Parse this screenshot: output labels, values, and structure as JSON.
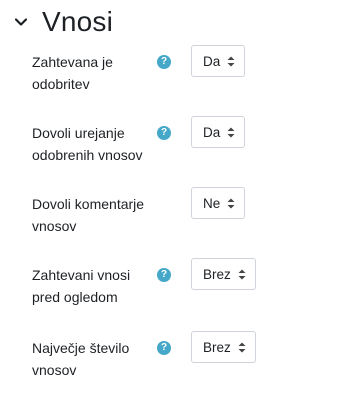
{
  "section": {
    "title": "Vnosi",
    "chevron_icon": "chevron-down-icon"
  },
  "settings": [
    {
      "label": "Zahtevana je odobritev",
      "help_icon": "help-icon",
      "value": "Da"
    },
    {
      "label": "Dovoli urejanje odobrenih vnosov",
      "help_icon": "help-icon",
      "value": "Da"
    },
    {
      "label": "Dovoli komentarje vnosov",
      "help_icon": null,
      "value": "Ne"
    },
    {
      "label": "Zahtevani vnosi pred ogledom",
      "help_icon": "help-icon",
      "value": "Brez"
    },
    {
      "label": "Največje število vnosov",
      "help_icon": "help-icon",
      "value": "Brez"
    }
  ],
  "colors": {
    "help_icon": "#45a8c9",
    "text": "#1d2125",
    "select_border": "#cfd4da"
  }
}
